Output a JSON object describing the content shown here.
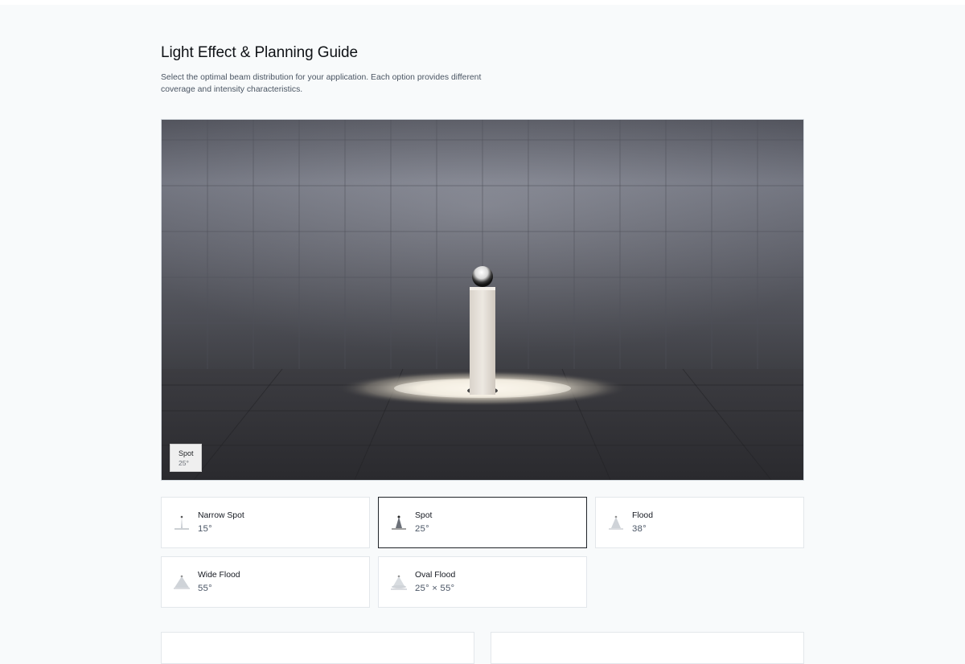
{
  "page": {
    "title": "Light Effect & Planning Guide",
    "description": "Select the optimal beam distribution for your application. Each option provides different coverage and intensity characteristics."
  },
  "preview": {
    "badge_name": "Spot",
    "badge_angle": "25°"
  },
  "beam_options": [
    {
      "name": "Narrow Spot",
      "angle": "15°",
      "icon": "narrow-spot-beam-icon",
      "selected": false
    },
    {
      "name": "Spot",
      "angle": "25°",
      "icon": "spot-beam-icon",
      "selected": true
    },
    {
      "name": "Flood",
      "angle": "38°",
      "icon": "flood-beam-icon",
      "selected": false
    },
    {
      "name": "Wide Flood",
      "angle": "55°",
      "icon": "wide-flood-beam-icon",
      "selected": false
    },
    {
      "name": "Oval Flood",
      "angle": "25° × 55°",
      "icon": "oval-flood-beam-icon",
      "selected": false
    }
  ],
  "colors": {
    "page_background": "#f8fafb",
    "selected_border": "#1f2328",
    "card_border": "#e3e7eb",
    "angle_text": "#4b5666"
  }
}
